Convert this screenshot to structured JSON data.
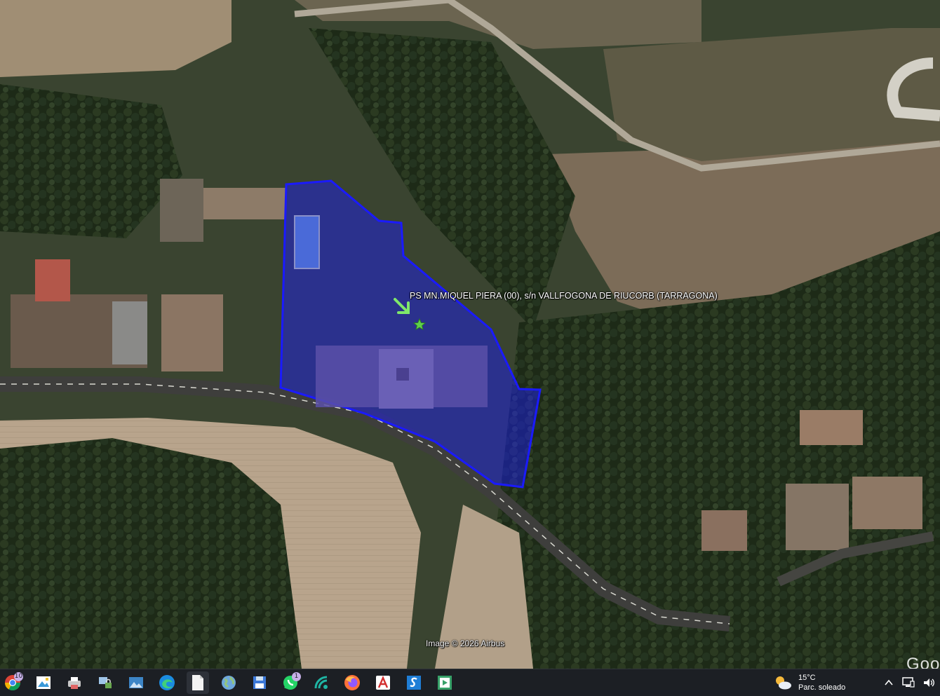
{
  "map": {
    "place_label": "PS MN.MIQUEL PIERA (00), s/n VALLFOGONA DE RIUCORB (TARRAGONA)",
    "copyright": "Image © 2026 Airbus",
    "google_mark": "Goo",
    "parcel_color": "#1a1aff",
    "marker_icon": "star-icon",
    "arrow_icon": "arrow-icon"
  },
  "taskbar": {
    "apps": [
      {
        "name": "chrome-icon",
        "badge": "10"
      },
      {
        "name": "photos-icon"
      },
      {
        "name": "printer-icon"
      },
      {
        "name": "network-lock-icon"
      },
      {
        "name": "photo-gallery-icon"
      },
      {
        "name": "edge-icon"
      },
      {
        "name": "document-icon"
      },
      {
        "name": "globe-icon"
      },
      {
        "name": "save-disk-icon"
      },
      {
        "name": "whatsapp-icon",
        "badge": "1"
      },
      {
        "name": "wifi-app-icon"
      },
      {
        "name": "firefox-icon"
      },
      {
        "name": "acrobat-icon"
      },
      {
        "name": "s-app-icon"
      },
      {
        "name": "player-icon"
      }
    ],
    "badges": {
      "chrome": "10",
      "whatsapp": "1"
    },
    "weather": {
      "temp": "15°C",
      "condition": "Parc. soleado"
    },
    "tray": {
      "chevron": "^"
    }
  }
}
